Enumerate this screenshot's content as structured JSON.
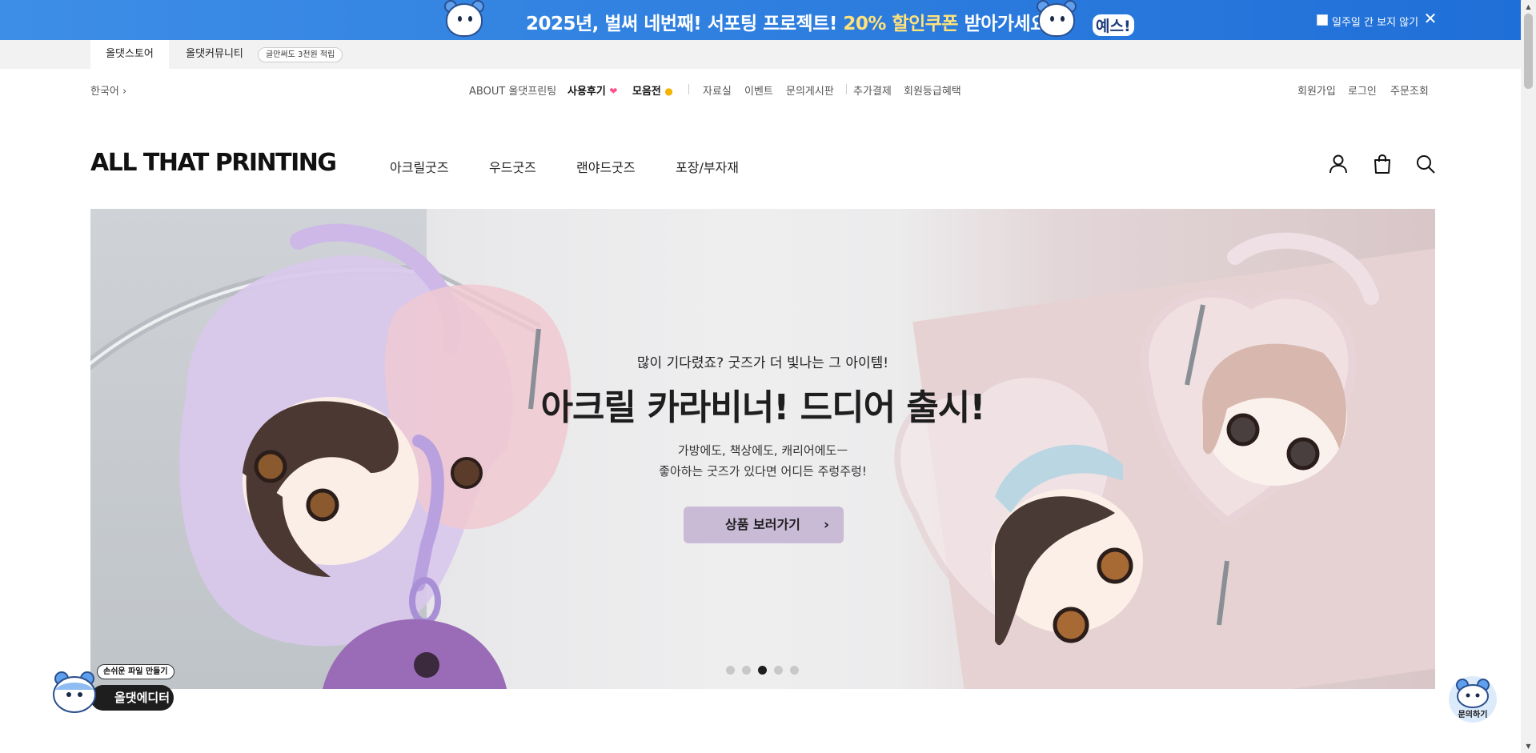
{
  "promo": {
    "text_prefix": "2025년, 벌써 네번째! ",
    "text_bold": "서포팅 프로젝트! ",
    "text_highlight": "20% 할인쿠폰",
    "text_suffix": " 받아가세요!",
    "bubble": "예스!",
    "hide_week_label": "일주일 간 보지 않기",
    "close_glyph": "✕"
  },
  "site_tabs": {
    "store": "올댓스토어",
    "community": "올댓커뮤니티",
    "badge": "글만써도 3천원 적립"
  },
  "util_nav": {
    "language": "한국어 ›",
    "about": "ABOUT 올댓프린팅",
    "reviews": "사용후기",
    "collection": "모음전",
    "resources": "자료실",
    "events": "이벤트",
    "inquiry_board": "문의게시판",
    "extra_payment": "추가결제",
    "member_benefits": "회원등급혜택",
    "signup": "회원가입",
    "login": "로그인",
    "order_lookup": "주문조회"
  },
  "header": {
    "logo": "ALL THAT PRINTING",
    "menu": [
      "아크릴굿즈",
      "우드굿즈",
      "랜야드굿즈",
      "포장/부자재"
    ],
    "icons": [
      "user-icon",
      "shopping-bag-icon",
      "search-icon"
    ]
  },
  "hero": {
    "subtitle": "많이 기다렸죠? 굿즈가 더 빛나는 그 아이템!",
    "title": "아크릴 카라비너! 드디어 출시!",
    "desc_line1": "가방에도, 책상에도, 캐리어에도ㅡ",
    "desc_line2": "좋아하는 굿즈가 있다면 어디든 주렁주렁!",
    "button": "상품 보러가기",
    "button_chevron": "›",
    "slides_total": 5,
    "active_slide": 3
  },
  "floating": {
    "editor_tag": "손쉬운 파일 만들기",
    "editor_label": "올댓에디터",
    "chat_label": "문의하기"
  },
  "scrollbar": {
    "up": "▲",
    "down": "▼"
  },
  "colors": {
    "promo_bg": "#2f7fe0",
    "promo_highlight": "#ffe27a",
    "button_bg": "#c9bad6",
    "dot_active": "#1e1e1e"
  }
}
